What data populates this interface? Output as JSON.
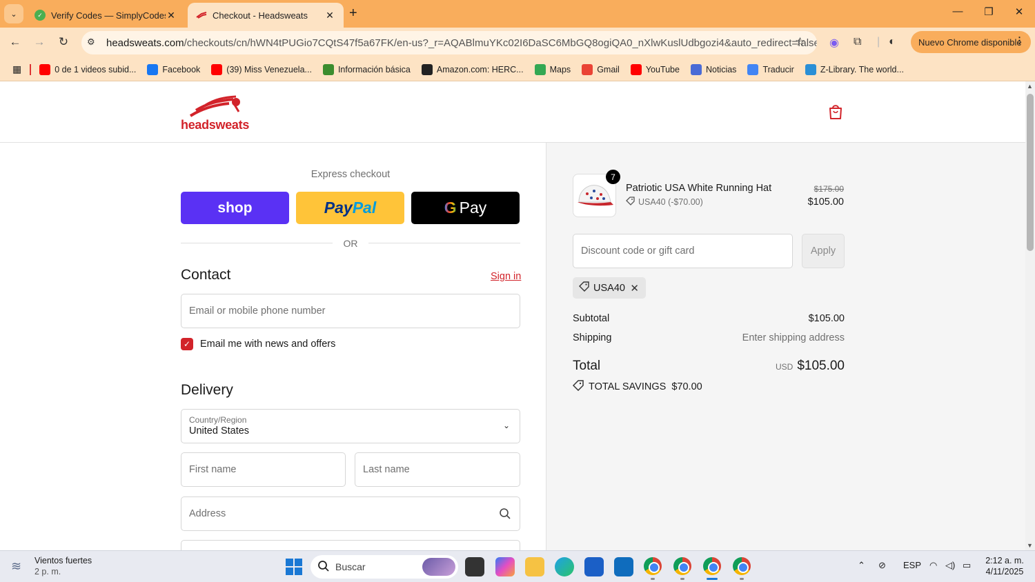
{
  "browser": {
    "tabs": [
      {
        "title": "Verify Codes — SimplyCodes",
        "active": false
      },
      {
        "title": "Checkout - Headsweats",
        "active": true
      }
    ],
    "url_domain": "headsweats.com",
    "url_path": "/checkouts/cn/hWN4tPUGio7CQtS47f5a67FK/en-us?_r=AQABlmuYKc02I6DaSC6MbGQ8ogiQA0_nXlwKuslUdbgozi4&auto_redirect=false&edge_r...",
    "update_button": "Nuevo Chrome disponible",
    "bookmarks": [
      {
        "label": "0 de 1 videos subid...",
        "icon": "youtube-icon",
        "color": "#ff0000"
      },
      {
        "label": "Facebook",
        "icon": "facebook-icon",
        "color": "#1877f2"
      },
      {
        "label": "(39) Miss Venezuela...",
        "icon": "youtube-icon",
        "color": "#ff0000"
      },
      {
        "label": "Información básica",
        "icon": "leaf-icon",
        "color": "#3c8d2f"
      },
      {
        "label": "Amazon.com: HERC...",
        "icon": "amazon-icon",
        "color": "#222222"
      },
      {
        "label": "Maps",
        "icon": "maps-icon",
        "color": "#34a853"
      },
      {
        "label": "Gmail",
        "icon": "gmail-icon",
        "color": "#ea4335"
      },
      {
        "label": "YouTube",
        "icon": "youtube-icon",
        "color": "#ff0000"
      },
      {
        "label": "Noticias",
        "icon": "news-icon",
        "color": "#4a6bd6"
      },
      {
        "label": "Traducir",
        "icon": "translate-icon",
        "color": "#4285f4"
      },
      {
        "label": "Z-Library. The world...",
        "icon": "globe-icon",
        "color": "#2a8fd6"
      }
    ]
  },
  "store": {
    "name": "headsweats",
    "brand_color": "#d2232a"
  },
  "checkout": {
    "express_title": "Express checkout",
    "shop_label": "shop",
    "paypal_a": "Pay",
    "paypal_b": "Pal",
    "gpay_g": "G",
    "gpay_label": "Pay",
    "or_text": "OR",
    "contact_title": "Contact",
    "sign_in": "Sign in",
    "email_placeholder": "Email or mobile phone number",
    "newsletter_label": "Email me with news and offers",
    "newsletter_checked": true,
    "delivery_title": "Delivery",
    "country_label": "Country/Region",
    "country_value": "United States",
    "first_name_placeholder": "First name",
    "last_name_placeholder": "Last name",
    "address_placeholder": "Address"
  },
  "summary": {
    "product": {
      "name": "Patriotic USA White Running Hat",
      "quantity": "7",
      "discount": "USA40 (-$70.00)",
      "original_price": "$175.00",
      "price": "$105.00"
    },
    "discount_placeholder": "Discount code or gift card",
    "apply_label": "Apply",
    "applied_code": "USA40",
    "subtotal_label": "Subtotal",
    "subtotal_value": "$105.00",
    "shipping_label": "Shipping",
    "shipping_value": "Enter shipping address",
    "total_label": "Total",
    "total_currency": "USD",
    "total_value": "$105.00",
    "savings_label": "TOTAL SAVINGS",
    "savings_value": "$70.00"
  },
  "taskbar": {
    "weather_title": "Vientos fuertes",
    "weather_sub": "2 p. m.",
    "search_label": "Buscar",
    "language": "ESP",
    "time": "2:12 a. m.",
    "date": "4/11/2025"
  }
}
